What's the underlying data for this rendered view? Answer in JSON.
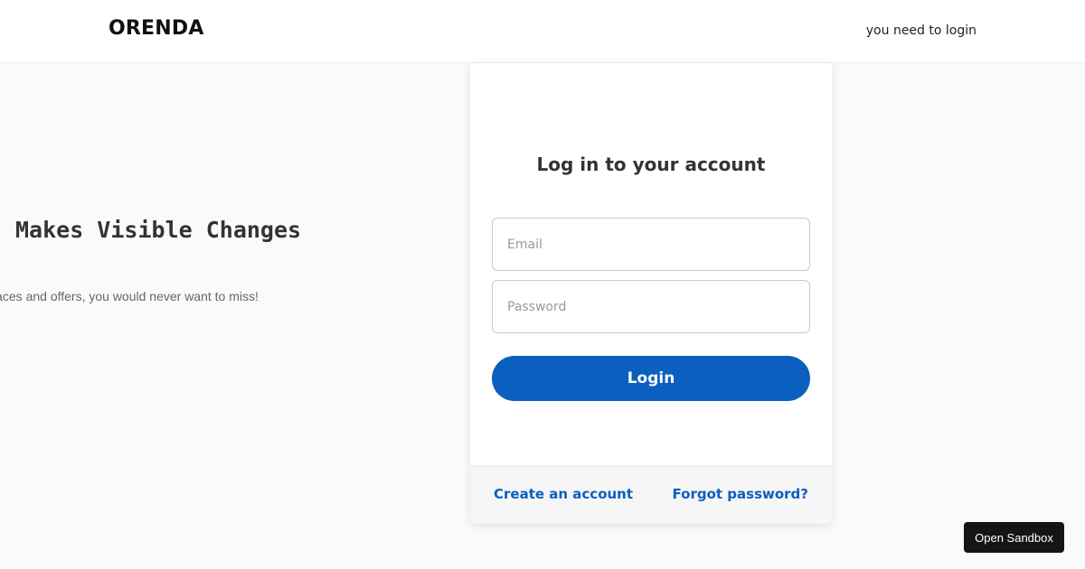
{
  "header": {
    "logo_text": "ORENDA",
    "status_text": "you need to login"
  },
  "hero": {
    "title": "Makes Visible Changes",
    "subtitle": "laces and offers, you would never want to miss!"
  },
  "login_card": {
    "title": "Log in to your account",
    "email": {
      "placeholder": "Email",
      "value": ""
    },
    "password": {
      "placeholder": "Password",
      "value": ""
    },
    "login_label": "Login",
    "create_account_label": "Create an account",
    "forgot_password_label": "Forgot password?"
  },
  "sandbox": {
    "label": "Open Sandbox"
  },
  "colors": {
    "accent": "#0b5fbf",
    "background": "#fafafa",
    "sandbox_button": "#151515"
  }
}
